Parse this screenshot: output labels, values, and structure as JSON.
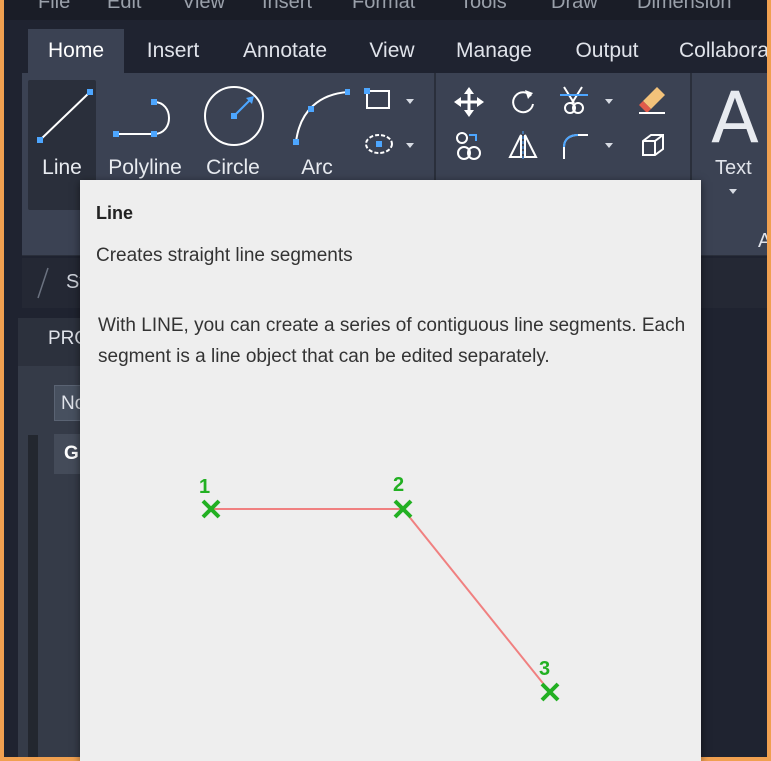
{
  "menubar": {
    "items": [
      "File",
      "Edit",
      "View",
      "Insert",
      "Format",
      "Tools",
      "Draw",
      "Dimension"
    ]
  },
  "ribbon_tabs": [
    "Home",
    "Insert",
    "Annotate",
    "View",
    "Manage",
    "Output",
    "Collabora"
  ],
  "active_tab": "Home",
  "draw_panel": {
    "line": "Line",
    "polyline": "Polyline",
    "circle": "Circle",
    "arc": "Arc"
  },
  "annotation_panel": {
    "text": "Text",
    "caption": "A"
  },
  "lower_bar": {
    "tab_fragment": "St"
  },
  "palette": {
    "title_fragment": "PRO",
    "field_fragment": "No",
    "header_fragment": "G"
  },
  "tooltip": {
    "title": "Line",
    "summary": "Creates straight line segments",
    "description": "With LINE, you can create a series of contiguous line segments. Each segment is a line object that can be edited separately.",
    "points": [
      "1",
      "2",
      "3"
    ]
  },
  "colors": {
    "accent_frame": "#f0a050",
    "ribbon_bg": "#3b4253",
    "tooltip_bg": "#eeeeee",
    "point_marker": "#22b022",
    "line_segment": "#f08080",
    "icon_blue": "#4da6ff"
  }
}
